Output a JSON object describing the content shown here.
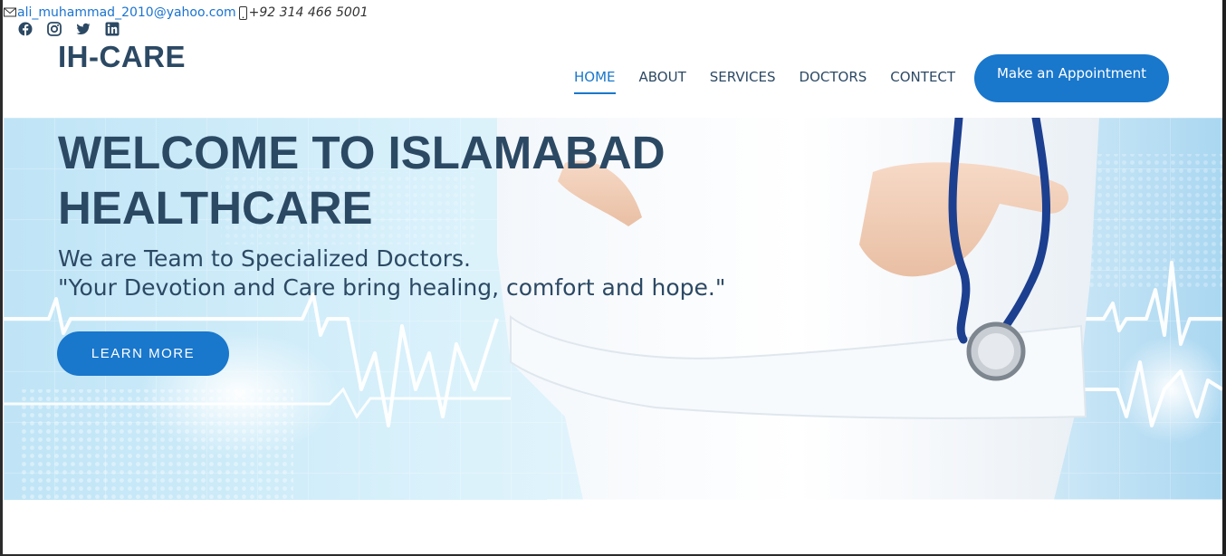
{
  "topbar": {
    "email": "ali_muhammad_2010@yahoo.com",
    "phone": "+92 314 466 5001",
    "email_icon": "envelope-icon",
    "phone_icon": "mobile-phone-icon"
  },
  "social": [
    "facebook-icon",
    "instagram-icon",
    "twitter-icon",
    "linkedin-icon"
  ],
  "header": {
    "logo": "IH-CARE",
    "nav": [
      {
        "label": "HOME",
        "active": true
      },
      {
        "label": "ABOUT",
        "active": false
      },
      {
        "label": "SERVICES",
        "active": false
      },
      {
        "label": "DOCTORS",
        "active": false
      },
      {
        "label": "CONTECT",
        "active": false
      }
    ],
    "appointment_label": "Make an Appointment"
  },
  "hero": {
    "title_line1": "WELCOME TO ISLAMABAD",
    "title_line2": "HEALTHCARE",
    "subtitle_line1": "We are Team to Specialized Doctors.",
    "subtitle_line2": "\"Your Devotion and Care bring healing, comfort and hope.\"",
    "cta_label": "LEARN MORE"
  },
  "colors": {
    "accent": "#1977cc",
    "heading": "#2c4964",
    "link": "#1a73d0"
  }
}
